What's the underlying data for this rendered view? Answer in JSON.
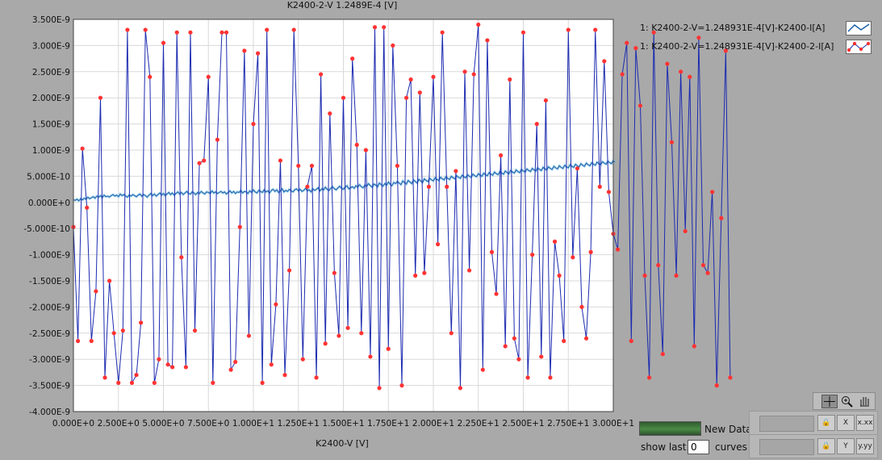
{
  "graph": {
    "top_label": "K2400-2-V 1.2489E-4 [V]",
    "x_axis_label": "K2400-V  [V]"
  },
  "legend": {
    "items": [
      {
        "label": "1: K2400-2-V=1.248931E-4[V]-K2400-I[A]",
        "color": "#1a5fa8",
        "marker": "none"
      },
      {
        "label": "1: K2400-2-V=1.248931E-4[V]-K2400-2-I[A]",
        "color": "#e33",
        "marker": "diamond"
      }
    ]
  },
  "controls": {
    "new_data_label": "New Data",
    "show_last_label": "show last",
    "show_last_value": "0",
    "curves_label": "curves",
    "x_format_btn": "x.xx",
    "y_format_btn": "y.yy",
    "x_lock_btn": "X",
    "y_lock_btn": "Y"
  },
  "colors": {
    "background": "#a9a9a9",
    "plot_bg": "#ffffff",
    "series1": "#1a5fa8",
    "series2_line": "#1c2bb0",
    "series2_marker": "#ff3333"
  },
  "chart_data": {
    "type": "line",
    "xlim": [
      0,
      30
    ],
    "ylim": [
      -4e-09,
      3.5e-09
    ],
    "x_ticks": [
      "0.000E+0",
      "2.500E+0",
      "5.000E+0",
      "7.500E+0",
      "1.000E+1",
      "1.250E+1",
      "1.500E+1",
      "1.750E+1",
      "2.000E+1",
      "2.250E+1",
      "2.500E+1",
      "2.750E+1",
      "3.000E+1"
    ],
    "y_ticks": [
      "3.500E-9",
      "3.000E-9",
      "2.500E-9",
      "2.000E-9",
      "1.500E-9",
      "1.000E-9",
      "5.000E-10",
      "0.000E+0",
      "-5.000E-10",
      "-1.000E-9",
      "-1.500E-9",
      "-2.000E-9",
      "-2.500E-9",
      "-3.000E-9",
      "-3.500E-9",
      "-4.000E-9"
    ],
    "grid": true,
    "series": [
      {
        "name": "1: K2400-2-V=1.248931E-4[V]-K2400-I[A]",
        "style": "line",
        "x_start": 0,
        "x_step": 0.1,
        "y": [
          5e-11,
          4e-11,
          6e-11,
          3e-11,
          7e-11,
          5e-11,
          8e-11,
          6e-11,
          1e-10,
          7e-11,
          9e-11,
          1.1e-10,
          8e-11,
          1.2e-10,
          1e-10,
          1.3e-10,
          9e-11,
          1.4e-10,
          1.1e-10,
          1.2e-10,
          1e-10,
          1.3e-10,
          1.5e-10,
          1.2e-10,
          1.4e-10,
          1.1e-10,
          1.6e-10,
          1.3e-10,
          1.5e-10,
          1.2e-10,
          1e-10,
          1.4e-10,
          1.2e-10,
          1.5e-10,
          1.3e-10,
          1.1e-10,
          1.4e-10,
          1.6e-10,
          1.2e-10,
          1.5e-10,
          1.3e-10,
          1e-10,
          1.4e-10,
          1.7e-10,
          1.3e-10,
          1.6e-10,
          1.2e-10,
          1.5e-10,
          1.8e-10,
          1.4e-10,
          1.7e-10,
          1.3e-10,
          1.6e-10,
          1.9e-10,
          1.5e-10,
          1.8e-10,
          1.4e-10,
          1.7e-10,
          2e-10,
          1.6e-10,
          1.9e-10,
          1.5e-10,
          1.8e-10,
          2.1e-10,
          1.7e-10,
          1.6e-10,
          2e-10,
          1.8e-10,
          1.5e-10,
          1.9e-10,
          1.7e-10,
          2.1e-10,
          1.8e-10,
          1.6e-10,
          2e-10,
          1.9e-10,
          1.7e-10,
          2.2e-10,
          1.8e-10,
          2e-10,
          1.7e-10,
          1.9e-10,
          2.1e-10,
          1.8e-10,
          2e-10,
          1.6e-10,
          1.9e-10,
          2.2e-10,
          1.8e-10,
          2.1e-10,
          1.7e-10,
          2e-10,
          1.9e-10,
          2.3e-10,
          1.8e-10,
          2.1e-10,
          2e-10,
          1.7e-10,
          2.2e-10,
          1.9e-10,
          2.4e-10,
          2e-10,
          1.8e-10,
          2.3e-10,
          2.1e-10,
          1.9e-10,
          2.4e-10,
          2e-10,
          2.2e-10,
          1.8e-10,
          2.3e-10,
          2.5e-10,
          2.1e-10,
          2.4e-10,
          1.9e-10,
          2.2e-10,
          2.6e-10,
          2e-10,
          2.3e-10,
          2.1e-10,
          2.5e-10,
          2.2e-10,
          2e-10,
          2.4e-10,
          2.6e-10,
          2.2e-10,
          2.5e-10,
          2.1e-10,
          2.3e-10,
          2.7e-10,
          2.2e-10,
          2.4e-10,
          2e-10,
          2.6e-10,
          2.3e-10,
          2.5e-10,
          2.8e-10,
          2.2e-10,
          2.6e-10,
          2.4e-10,
          2.9e-10,
          2.5e-10,
          2.3e-10,
          2.7e-10,
          3e-10,
          2.6e-10,
          2.4e-10,
          2.8e-10,
          3.1e-10,
          2.7e-10,
          2.5e-10,
          2.9e-10,
          3.2e-10,
          2.6e-10,
          2.8e-10,
          3e-10,
          2.7e-10,
          3.2e-10,
          2.9e-10,
          3.4e-10,
          3e-10,
          2.8e-10,
          3.3e-10,
          3.1e-10,
          3.6e-10,
          3.2e-10,
          2.9e-10,
          3.5e-10,
          3.3e-10,
          3e-10,
          3.7e-10,
          3.4e-10,
          3.1e-10,
          3.6e-10,
          3.3e-10,
          3.9e-10,
          3.5e-10,
          3.2e-10,
          3.8e-10,
          3.6e-10,
          4e-10,
          3.7e-10,
          3.4e-10,
          4.1e-10,
          3.8e-10,
          3.5e-10,
          4.2e-10,
          3.9e-10,
          3.6e-10,
          4.3e-10,
          4e-10,
          3.7e-10,
          4.4e-10,
          4.1e-10,
          3.8e-10,
          4.5e-10,
          4.2e-10,
          4e-10,
          4.6e-10,
          4.3e-10,
          4.1e-10,
          4.7e-10,
          4.4e-10,
          4.2e-10,
          4.8e-10,
          4.5e-10,
          4.3e-10,
          4.9e-10,
          4.6e-10,
          4.4e-10,
          5e-10,
          4.7e-10,
          4.5e-10,
          5.1e-10,
          4.8e-10,
          4.6e-10,
          5.2e-10,
          4.9e-10,
          4.7e-10,
          5.3e-10,
          5e-10,
          4.8e-10,
          5.4e-10,
          5.1e-10,
          4.9e-10,
          5.5e-10,
          5.2e-10,
          5e-10,
          5.6e-10,
          5.3e-10,
          5.1e-10,
          5.7e-10,
          5.4e-10,
          5.2e-10,
          5.8e-10,
          5.5e-10,
          5.3e-10,
          5.9e-10,
          5.6e-10,
          5.4e-10,
          6e-10,
          5.7e-10,
          5.5e-10,
          6.1e-10,
          5.8e-10,
          5.6e-10,
          6.2e-10,
          5.9e-10,
          5.7e-10,
          6.3e-10,
          6e-10,
          5.8e-10,
          6.4e-10,
          6.1e-10,
          5.9e-10,
          6.5e-10,
          6.2e-10,
          6e-10,
          6.6e-10,
          6.3e-10,
          6.1e-10,
          6.7e-10,
          6.4e-10,
          6.2e-10,
          6.8e-10,
          6.5e-10,
          6.3e-10,
          6.9e-10,
          6.6e-10,
          6.4e-10,
          7e-10,
          6.7e-10,
          6.5e-10,
          7.1e-10,
          6.8e-10,
          6.6e-10,
          7.2e-10,
          6.9e-10,
          6.7e-10,
          7.3e-10,
          7e-10,
          6.8e-10,
          7.4e-10,
          7.1e-10,
          6.9e-10,
          7.5e-10,
          7.2e-10,
          7e-10,
          7.6e-10,
          7.3e-10,
          7.1e-10,
          7.7e-10,
          7.4e-10,
          7.2e-10,
          7.8e-10,
          7.5e-10,
          7.3e-10,
          7.9e-10,
          7.6e-10,
          7.4e-10,
          8e-10,
          7.7e-10
        ]
      },
      {
        "name": "1: K2400-2-V=1.248931E-4[V]-K2400-2-I[A]",
        "style": "line+markers",
        "x_start": 0,
        "x_step": 0.25,
        "y": [
          -4.7e-10,
          -2.65e-09,
          1.03e-09,
          -1e-10,
          -2.65e-09,
          -1.7e-09,
          2e-09,
          -3.35e-09,
          -1.5e-09,
          -2.5e-09,
          -3.45e-09,
          -2.45e-09,
          3.3e-09,
          -3.45e-09,
          -3.3e-09,
          -2.3e-09,
          3.3e-09,
          2.4e-09,
          -3.45e-09,
          -3e-09,
          3.05e-09,
          -3.1e-09,
          -3.15e-09,
          3.25e-09,
          -1.05e-09,
          -3.15e-09,
          3.25e-09,
          -2.45e-09,
          7.5e-10,
          8e-10,
          2.4e-09,
          -3.45e-09,
          1.2e-09,
          3.25e-09,
          3.25e-09,
          -3.2e-09,
          -3.05e-09,
          -4.7e-10,
          2.9e-09,
          -2.55e-09,
          1.5e-09,
          2.85e-09,
          -3.45e-09,
          3.3e-09,
          -3.1e-09,
          -1.95e-09,
          8e-10,
          -3.3e-09,
          -1.3e-09,
          3.3e-09,
          7e-10,
          -3e-09,
          3e-10,
          7e-10,
          -3.35e-09,
          2.45e-09,
          -2.7e-09,
          1.7e-09,
          -1.35e-09,
          -2.55e-09,
          2e-09,
          -2.4e-09,
          2.75e-09,
          1.1e-09,
          -2.5e-09,
          1e-09,
          -2.95e-09,
          3.35e-09,
          -3.55e-09,
          3.35e-09,
          -2.8e-09,
          3e-09,
          7e-10,
          -3.5e-09,
          2e-09,
          2.35e-09,
          -1.4e-09,
          2.1e-09,
          -1.35e-09,
          3e-10,
          2.4e-09,
          -8e-10,
          3.25e-09,
          3e-10,
          -2.5e-09,
          6e-10,
          -3.55e-09,
          2.5e-09,
          -1.3e-09,
          2.45e-09,
          3.4e-09,
          -3.2e-09,
          3.1e-09,
          -9.5e-10,
          -1.75e-09,
          9e-10,
          -2.75e-09,
          2.35e-09,
          -2.6e-09,
          -3e-09,
          3.25e-09,
          -3.35e-09,
          -1e-09,
          1.5e-09,
          -2.95e-09,
          1.95e-09,
          -3.35e-09,
          -7.5e-10,
          -1.4e-09,
          -2.65e-09,
          3.3e-09,
          -1.05e-09,
          6.5e-10,
          -2e-09,
          -2.6e-09,
          -9.5e-10,
          3.3e-09,
          3e-10,
          2.7e-09,
          2e-10,
          -6e-10,
          -9e-10,
          2.45e-09,
          3.05e-09,
          -2.65e-09,
          2.95e-09,
          1.85e-09,
          -1.4e-09,
          -3.35e-09,
          3.25e-09,
          -1.2e-09,
          -2.9e-09,
          2.65e-09,
          1.15e-09,
          -1.4e-09,
          2.5e-09,
          -5.5e-10,
          2.4e-09,
          -2.75e-09,
          3.15e-09,
          -1.2e-09,
          -1.35e-09,
          2e-10,
          -3.5e-09,
          -3e-10,
          2.9e-09,
          -3.35e-09
        ]
      }
    ]
  }
}
